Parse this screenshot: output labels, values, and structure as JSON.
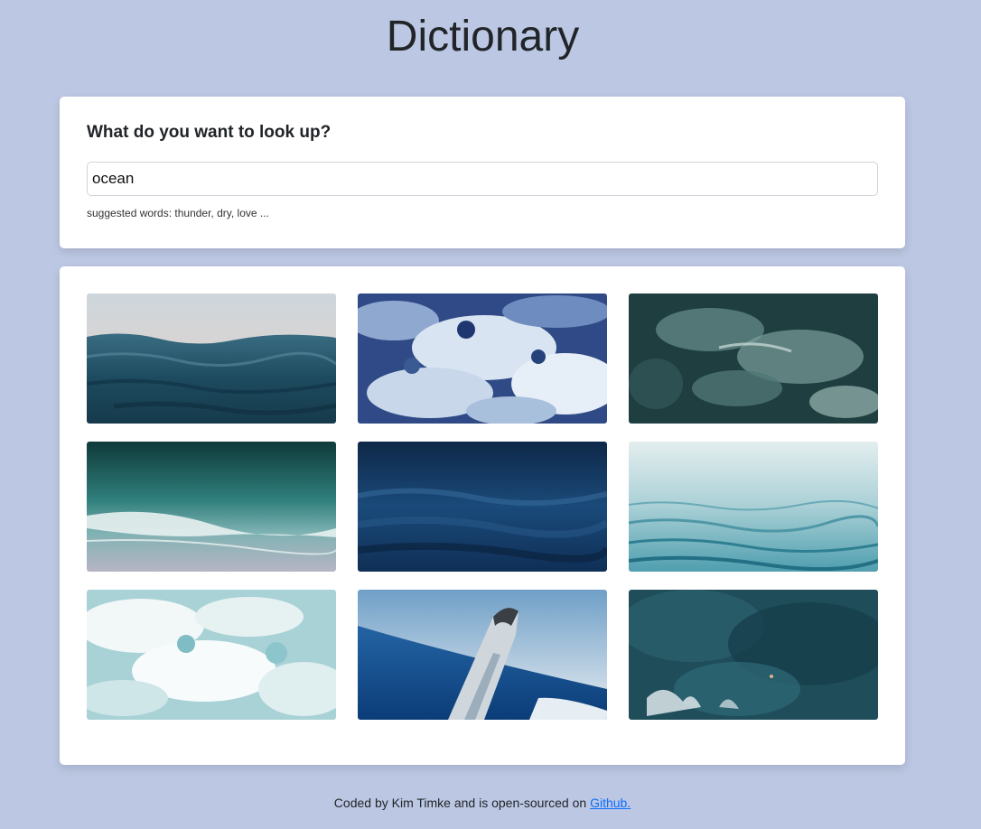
{
  "app": {
    "title": "Dictionary"
  },
  "search": {
    "heading": "What do you want to look up?",
    "value": "ocean",
    "hint": "suggested words: thunder, dry, love ..."
  },
  "photos": [
    {
      "subject": "calm sea at dusk"
    },
    {
      "subject": "white water foam"
    },
    {
      "subject": "dark churning water"
    },
    {
      "subject": "wave on sandy beach"
    },
    {
      "subject": "deep blue water"
    },
    {
      "subject": "pale ripples"
    },
    {
      "subject": "sea foam"
    },
    {
      "subject": "breaching whale"
    },
    {
      "subject": "aerial dark ocean"
    }
  ],
  "footer": {
    "text": "Coded by Kim Timke and is open-sourced on ",
    "link_label": "Github."
  },
  "colors": {
    "page_background": "#bcc7e3",
    "card_background": "#ffffff",
    "link": "#0d6efd"
  }
}
